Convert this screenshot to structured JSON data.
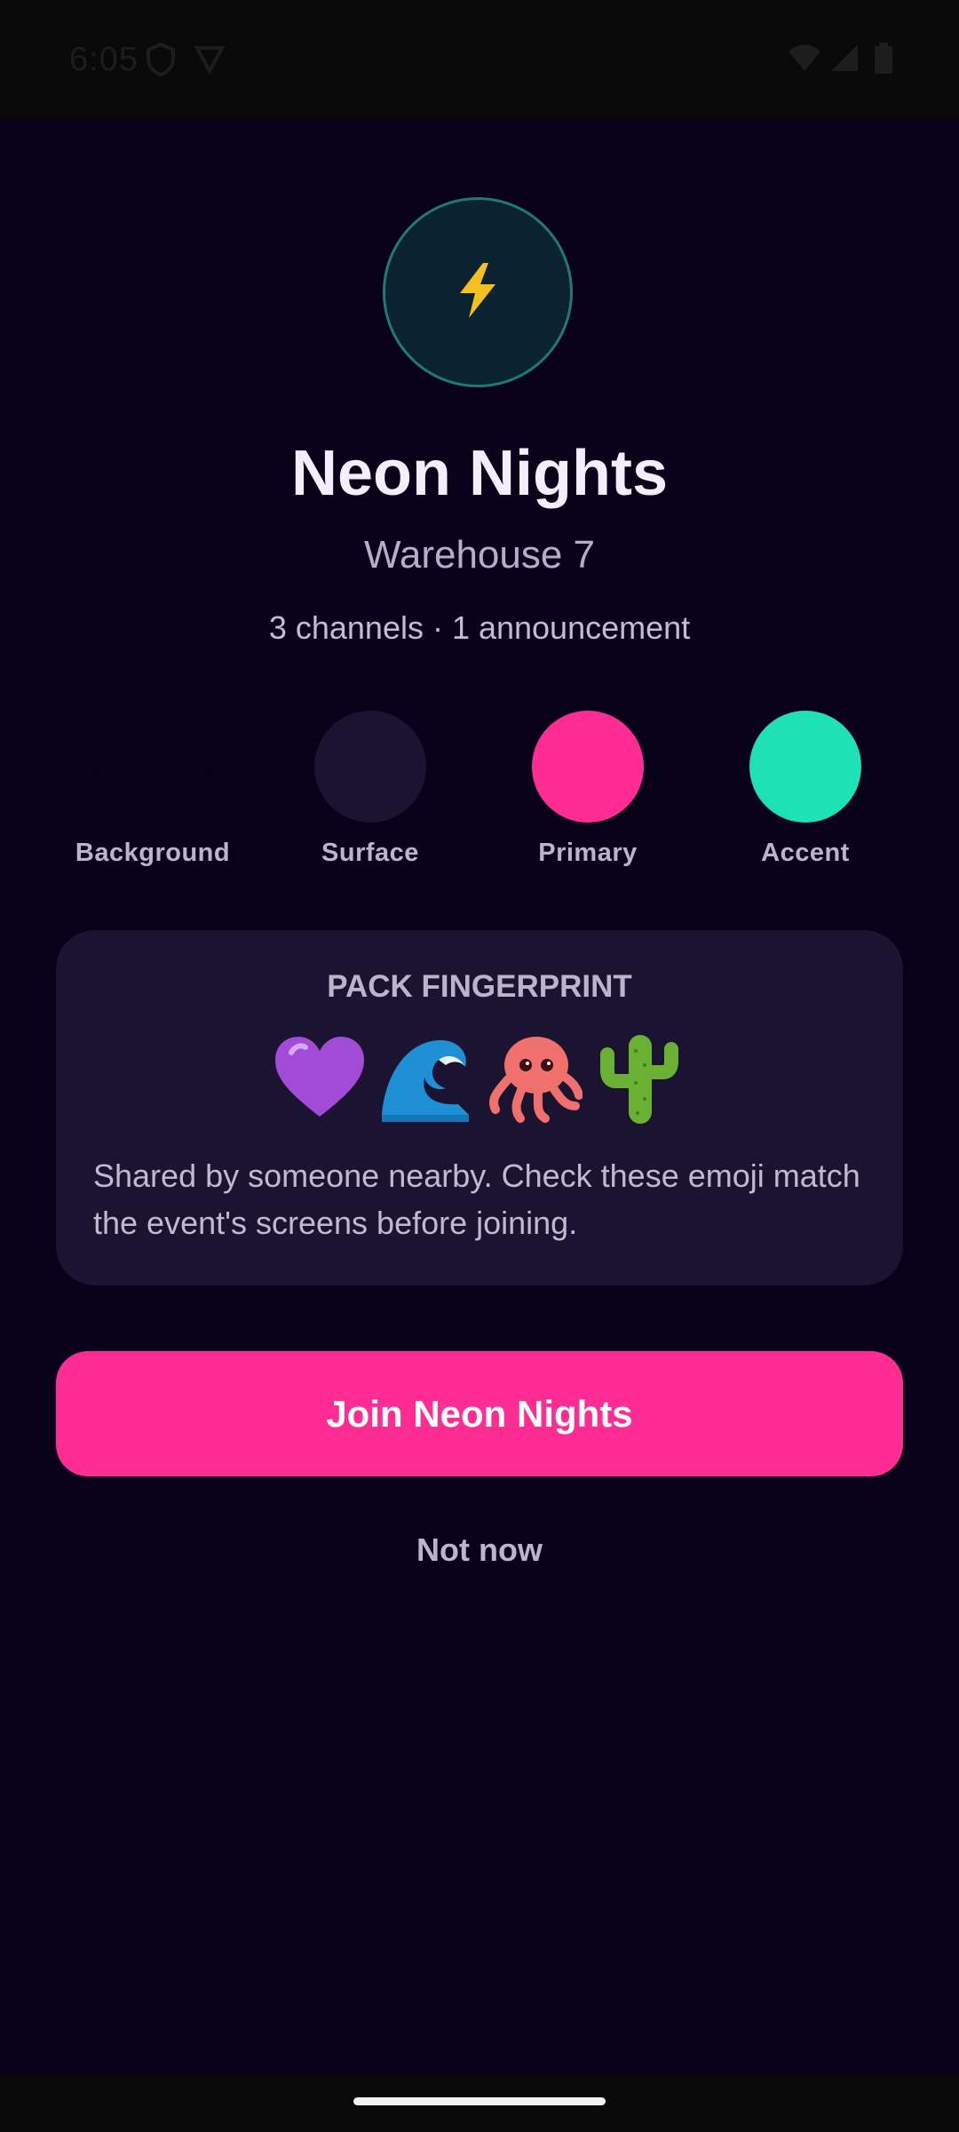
{
  "status_bar": {
    "time": "6:05"
  },
  "event": {
    "icon": "lightning-bolt-icon",
    "name": "Neon Nights",
    "venue": "Warehouse 7",
    "summary": "3 channels · 1 announcement"
  },
  "palette": [
    {
      "label": "Background",
      "color": "#09011a"
    },
    {
      "label": "Surface",
      "color": "#1b1430"
    },
    {
      "label": "Primary",
      "color": "#ff2c93"
    },
    {
      "label": "Accent",
      "color": "#1de2b3"
    }
  ],
  "fingerprint": {
    "title": "PACK FINGERPRINT",
    "emoji": [
      "purple-heart-icon",
      "water-wave-icon",
      "octopus-icon",
      "cactus-icon"
    ],
    "description": "Shared by someone nearby. Check these emoji match the event's screens before joining."
  },
  "actions": {
    "join_label": "Join Neon Nights",
    "dismiss_label": "Not now"
  },
  "colors": {
    "background": "#09011a",
    "surface": "#1b1430",
    "primary": "#ff2c93",
    "accent": "#1de2b3",
    "text": "#f3eefb"
  }
}
